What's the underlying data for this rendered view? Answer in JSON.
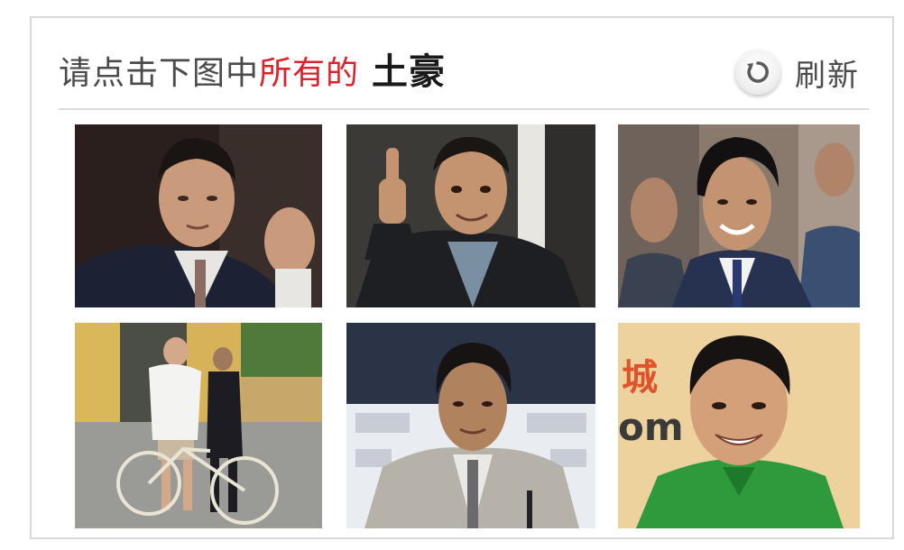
{
  "captcha": {
    "prompt": {
      "lead": "请点击下图中",
      "highlight": "所有的",
      "target": "土豪"
    },
    "refresh": {
      "icon": "refresh-icon",
      "label": "刷新"
    },
    "tiles": [
      {
        "name": "photo-tile-1",
        "subject": "older-man-gesturing-suit"
      },
      {
        "name": "photo-tile-2",
        "subject": "man-thumbs-up-suit"
      },
      {
        "name": "photo-tile-3",
        "subject": "smiling-man-suit-tie"
      },
      {
        "name": "photo-tile-4",
        "subject": "man-with-bicycle-street"
      },
      {
        "name": "photo-tile-5",
        "subject": "man-at-press-conference"
      },
      {
        "name": "photo-tile-6",
        "subject": "man-green-shirt-logo-wall",
        "visible_text": "城 om"
      }
    ]
  }
}
